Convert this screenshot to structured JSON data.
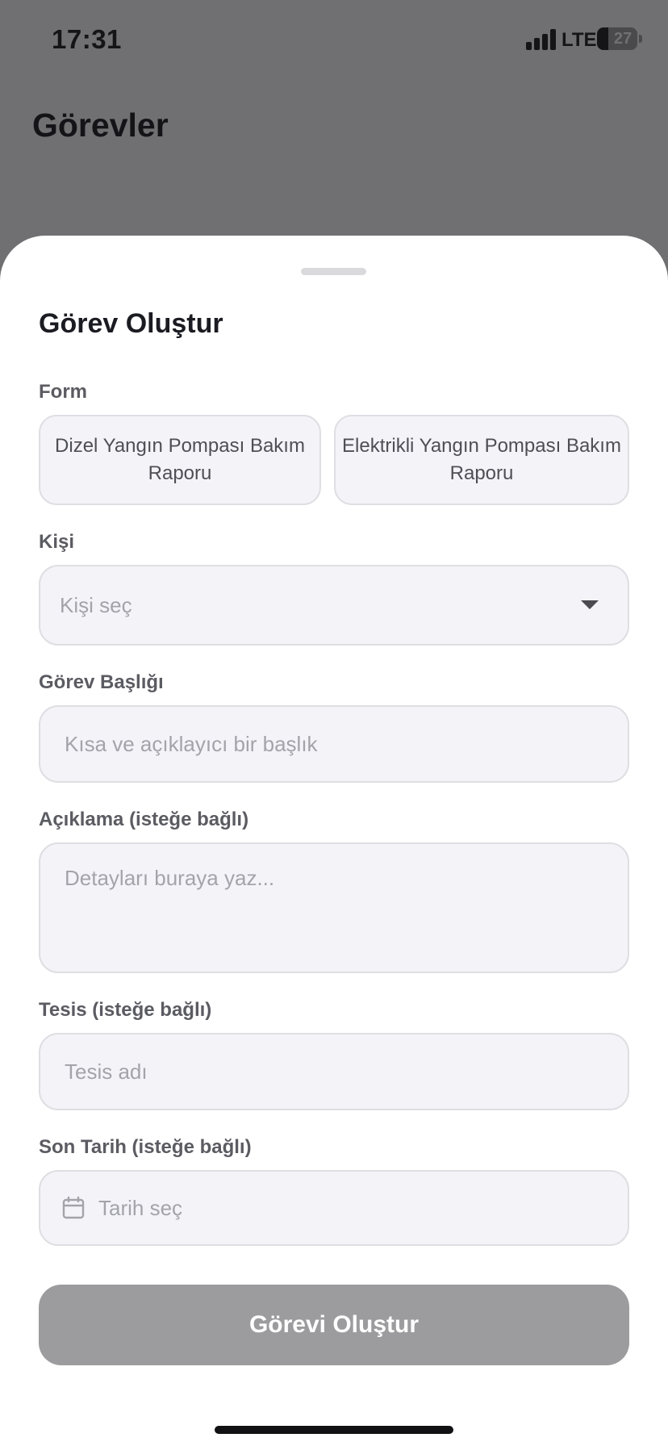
{
  "status_bar": {
    "time": "17:31",
    "network": "LTE",
    "battery": "27"
  },
  "background": {
    "page_title": "Görevler"
  },
  "sheet": {
    "title": "Görev Oluştur",
    "form_label": "Form",
    "form_options": [
      "Dizel Yangın Pompası Bakım Raporu",
      "Elektrikli Yangın Pompası Bakım Raporu"
    ],
    "person_label": "Kişi",
    "person_placeholder": "Kişi seç",
    "task_title_label": "Görev Başlığı",
    "task_title_placeholder": "Kısa ve açıklayıcı bir başlık",
    "description_label": "Açıklama (isteğe bağlı)",
    "description_placeholder": "Detayları buraya yaz...",
    "facility_label": "Tesis (isteğe bağlı)",
    "facility_placeholder": "Tesis adı",
    "due_date_label": "Son Tarih (isteğe bağlı)",
    "due_date_placeholder": "Tarih seç",
    "submit_label": "Görevi Oluştur"
  },
  "colors": {
    "overlay": "#707073",
    "field_bg": "#f4f4f8",
    "field_border": "#dedee3",
    "placeholder": "#a3a3aa",
    "button_disabled": "#9c9c9e"
  },
  "icons": [
    "cellular-signal-icon",
    "battery-icon",
    "chevron-down-icon",
    "calendar-icon"
  ]
}
